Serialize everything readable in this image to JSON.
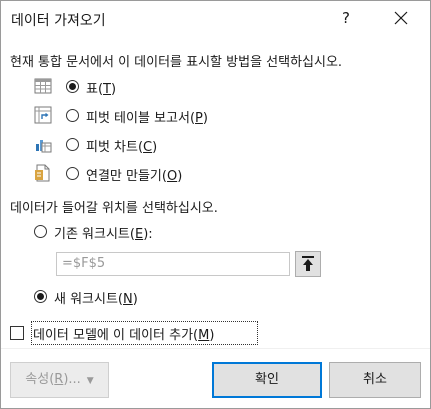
{
  "titlebar": {
    "title": "데이터 가져오기",
    "help_glyph": "?"
  },
  "section_view": {
    "prompt": "현재 통합 문서에서 이 데이터를 표시할 방법을 선택하십시오.",
    "options": [
      {
        "label": "표(",
        "mnemonic": "T",
        "suffix": ")",
        "icon": "table-icon",
        "checked": true
      },
      {
        "label": "피벗 테이블 보고서(",
        "mnemonic": "P",
        "suffix": ")",
        "icon": "pivottable-icon",
        "checked": false
      },
      {
        "label": "피벗 차트(",
        "mnemonic": "C",
        "suffix": ")",
        "icon": "pivotchart-icon",
        "checked": false
      },
      {
        "label": "연결만 만들기(",
        "mnemonic": "O",
        "suffix": ")",
        "icon": "connection-only-icon",
        "checked": false
      }
    ]
  },
  "section_location": {
    "prompt": "데이터가 들어갈 위치를 선택하십시오.",
    "existing": {
      "label": "기존 워크시트(",
      "mnemonic": "E",
      "suffix": "):",
      "checked": false
    },
    "range_value": "=$F$5",
    "new": {
      "label": "새 워크시트(",
      "mnemonic": "N",
      "suffix": ")",
      "checked": true
    }
  },
  "data_model": {
    "label": "데이터 모델에 이 데이터 추가(",
    "mnemonic": "M",
    "suffix": ")",
    "checked": false
  },
  "buttons": {
    "properties": {
      "label": "속성(",
      "mnemonic": "R",
      "suffix": ")..."
    },
    "ok": "확인",
    "cancel": "취소"
  },
  "colors": {
    "accent_border": "#0078d7",
    "button_face": "#e1e1e1",
    "disabled_text": "#9a9a9a"
  }
}
